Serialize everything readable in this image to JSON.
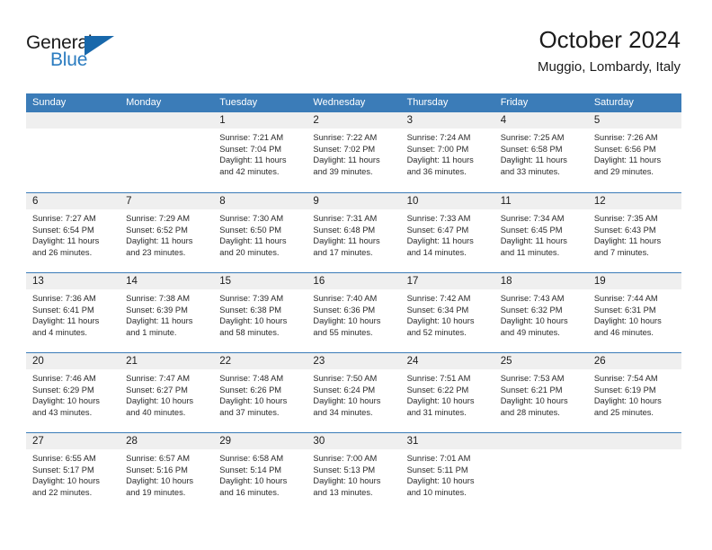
{
  "brand": {
    "name_top": "General",
    "name_bottom": "Blue",
    "accent_color": "#2b7cc0",
    "triangle_color": "#1868ab"
  },
  "header": {
    "title": "October 2024",
    "subtitle": "Muggio, Lombardy, Italy"
  },
  "theme": {
    "header_row_bg": "#3b7cb8",
    "day_band_bg": "#efefef",
    "rule_color": "#3b7cb8",
    "text_color": "#1b1b1b"
  },
  "weekday_headers": [
    "Sunday",
    "Monday",
    "Tuesday",
    "Wednesday",
    "Thursday",
    "Friday",
    "Saturday"
  ],
  "labels": {
    "sunrise_prefix": "Sunrise:",
    "sunset_prefix": "Sunset:",
    "daylight_prefix": "Daylight:"
  },
  "weeks": [
    [
      {
        "day": "",
        "sunrise": "",
        "sunset": "",
        "daylight_line1": "",
        "daylight_line2": ""
      },
      {
        "day": "",
        "sunrise": "",
        "sunset": "",
        "daylight_line1": "",
        "daylight_line2": ""
      },
      {
        "day": "1",
        "sunrise": "Sunrise: 7:21 AM",
        "sunset": "Sunset: 7:04 PM",
        "daylight_line1": "Daylight: 11 hours",
        "daylight_line2": "and 42 minutes."
      },
      {
        "day": "2",
        "sunrise": "Sunrise: 7:22 AM",
        "sunset": "Sunset: 7:02 PM",
        "daylight_line1": "Daylight: 11 hours",
        "daylight_line2": "and 39 minutes."
      },
      {
        "day": "3",
        "sunrise": "Sunrise: 7:24 AM",
        "sunset": "Sunset: 7:00 PM",
        "daylight_line1": "Daylight: 11 hours",
        "daylight_line2": "and 36 minutes."
      },
      {
        "day": "4",
        "sunrise": "Sunrise: 7:25 AM",
        "sunset": "Sunset: 6:58 PM",
        "daylight_line1": "Daylight: 11 hours",
        "daylight_line2": "and 33 minutes."
      },
      {
        "day": "5",
        "sunrise": "Sunrise: 7:26 AM",
        "sunset": "Sunset: 6:56 PM",
        "daylight_line1": "Daylight: 11 hours",
        "daylight_line2": "and 29 minutes."
      }
    ],
    [
      {
        "day": "6",
        "sunrise": "Sunrise: 7:27 AM",
        "sunset": "Sunset: 6:54 PM",
        "daylight_line1": "Daylight: 11 hours",
        "daylight_line2": "and 26 minutes."
      },
      {
        "day": "7",
        "sunrise": "Sunrise: 7:29 AM",
        "sunset": "Sunset: 6:52 PM",
        "daylight_line1": "Daylight: 11 hours",
        "daylight_line2": "and 23 minutes."
      },
      {
        "day": "8",
        "sunrise": "Sunrise: 7:30 AM",
        "sunset": "Sunset: 6:50 PM",
        "daylight_line1": "Daylight: 11 hours",
        "daylight_line2": "and 20 minutes."
      },
      {
        "day": "9",
        "sunrise": "Sunrise: 7:31 AM",
        "sunset": "Sunset: 6:48 PM",
        "daylight_line1": "Daylight: 11 hours",
        "daylight_line2": "and 17 minutes."
      },
      {
        "day": "10",
        "sunrise": "Sunrise: 7:33 AM",
        "sunset": "Sunset: 6:47 PM",
        "daylight_line1": "Daylight: 11 hours",
        "daylight_line2": "and 14 minutes."
      },
      {
        "day": "11",
        "sunrise": "Sunrise: 7:34 AM",
        "sunset": "Sunset: 6:45 PM",
        "daylight_line1": "Daylight: 11 hours",
        "daylight_line2": "and 11 minutes."
      },
      {
        "day": "12",
        "sunrise": "Sunrise: 7:35 AM",
        "sunset": "Sunset: 6:43 PM",
        "daylight_line1": "Daylight: 11 hours",
        "daylight_line2": "and 7 minutes."
      }
    ],
    [
      {
        "day": "13",
        "sunrise": "Sunrise: 7:36 AM",
        "sunset": "Sunset: 6:41 PM",
        "daylight_line1": "Daylight: 11 hours",
        "daylight_line2": "and 4 minutes."
      },
      {
        "day": "14",
        "sunrise": "Sunrise: 7:38 AM",
        "sunset": "Sunset: 6:39 PM",
        "daylight_line1": "Daylight: 11 hours",
        "daylight_line2": "and 1 minute."
      },
      {
        "day": "15",
        "sunrise": "Sunrise: 7:39 AM",
        "sunset": "Sunset: 6:38 PM",
        "daylight_line1": "Daylight: 10 hours",
        "daylight_line2": "and 58 minutes."
      },
      {
        "day": "16",
        "sunrise": "Sunrise: 7:40 AM",
        "sunset": "Sunset: 6:36 PM",
        "daylight_line1": "Daylight: 10 hours",
        "daylight_line2": "and 55 minutes."
      },
      {
        "day": "17",
        "sunrise": "Sunrise: 7:42 AM",
        "sunset": "Sunset: 6:34 PM",
        "daylight_line1": "Daylight: 10 hours",
        "daylight_line2": "and 52 minutes."
      },
      {
        "day": "18",
        "sunrise": "Sunrise: 7:43 AM",
        "sunset": "Sunset: 6:32 PM",
        "daylight_line1": "Daylight: 10 hours",
        "daylight_line2": "and 49 minutes."
      },
      {
        "day": "19",
        "sunrise": "Sunrise: 7:44 AM",
        "sunset": "Sunset: 6:31 PM",
        "daylight_line1": "Daylight: 10 hours",
        "daylight_line2": "and 46 minutes."
      }
    ],
    [
      {
        "day": "20",
        "sunrise": "Sunrise: 7:46 AM",
        "sunset": "Sunset: 6:29 PM",
        "daylight_line1": "Daylight: 10 hours",
        "daylight_line2": "and 43 minutes."
      },
      {
        "day": "21",
        "sunrise": "Sunrise: 7:47 AM",
        "sunset": "Sunset: 6:27 PM",
        "daylight_line1": "Daylight: 10 hours",
        "daylight_line2": "and 40 minutes."
      },
      {
        "day": "22",
        "sunrise": "Sunrise: 7:48 AM",
        "sunset": "Sunset: 6:26 PM",
        "daylight_line1": "Daylight: 10 hours",
        "daylight_line2": "and 37 minutes."
      },
      {
        "day": "23",
        "sunrise": "Sunrise: 7:50 AM",
        "sunset": "Sunset: 6:24 PM",
        "daylight_line1": "Daylight: 10 hours",
        "daylight_line2": "and 34 minutes."
      },
      {
        "day": "24",
        "sunrise": "Sunrise: 7:51 AM",
        "sunset": "Sunset: 6:22 PM",
        "daylight_line1": "Daylight: 10 hours",
        "daylight_line2": "and 31 minutes."
      },
      {
        "day": "25",
        "sunrise": "Sunrise: 7:53 AM",
        "sunset": "Sunset: 6:21 PM",
        "daylight_line1": "Daylight: 10 hours",
        "daylight_line2": "and 28 minutes."
      },
      {
        "day": "26",
        "sunrise": "Sunrise: 7:54 AM",
        "sunset": "Sunset: 6:19 PM",
        "daylight_line1": "Daylight: 10 hours",
        "daylight_line2": "and 25 minutes."
      }
    ],
    [
      {
        "day": "27",
        "sunrise": "Sunrise: 6:55 AM",
        "sunset": "Sunset: 5:17 PM",
        "daylight_line1": "Daylight: 10 hours",
        "daylight_line2": "and 22 minutes."
      },
      {
        "day": "28",
        "sunrise": "Sunrise: 6:57 AM",
        "sunset": "Sunset: 5:16 PM",
        "daylight_line1": "Daylight: 10 hours",
        "daylight_line2": "and 19 minutes."
      },
      {
        "day": "29",
        "sunrise": "Sunrise: 6:58 AM",
        "sunset": "Sunset: 5:14 PM",
        "daylight_line1": "Daylight: 10 hours",
        "daylight_line2": "and 16 minutes."
      },
      {
        "day": "30",
        "sunrise": "Sunrise: 7:00 AM",
        "sunset": "Sunset: 5:13 PM",
        "daylight_line1": "Daylight: 10 hours",
        "daylight_line2": "and 13 minutes."
      },
      {
        "day": "31",
        "sunrise": "Sunrise: 7:01 AM",
        "sunset": "Sunset: 5:11 PM",
        "daylight_line1": "Daylight: 10 hours",
        "daylight_line2": "and 10 minutes."
      },
      {
        "day": "",
        "sunrise": "",
        "sunset": "",
        "daylight_line1": "",
        "daylight_line2": ""
      },
      {
        "day": "",
        "sunrise": "",
        "sunset": "",
        "daylight_line1": "",
        "daylight_line2": ""
      }
    ]
  ]
}
